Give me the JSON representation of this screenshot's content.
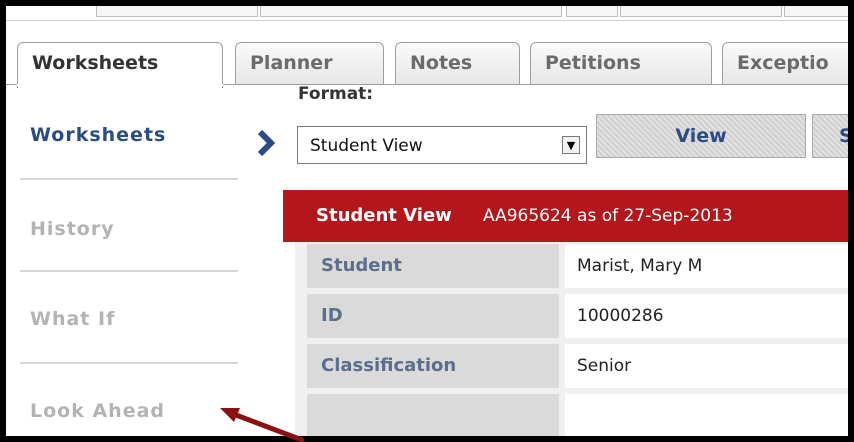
{
  "tabs": [
    {
      "label": "Worksheets"
    },
    {
      "label": "Planner"
    },
    {
      "label": "Notes"
    },
    {
      "label": "Petitions"
    },
    {
      "label": "Exceptio"
    }
  ],
  "nav": {
    "items": [
      {
        "label": "Worksheets"
      },
      {
        "label": "History"
      },
      {
        "label": "What If"
      },
      {
        "label": "Look Ahead"
      }
    ]
  },
  "format": {
    "label": "Format:",
    "selected": "Student View"
  },
  "buttons": {
    "view": "View",
    "second": "S"
  },
  "header": {
    "title": "Student View",
    "subtitle": "AA965624 as of 27-Sep-2013"
  },
  "info": [
    {
      "label": "Student",
      "value": "Marist, Mary M"
    },
    {
      "label": "ID",
      "value": "10000286"
    },
    {
      "label": "Classification",
      "value": "Senior"
    }
  ],
  "colors": {
    "accent_red": "#b3171c",
    "nav_active": "#2a4c84"
  },
  "icons": [
    "chevron-right-icon",
    "dropdown-arrow-icon",
    "red-pointer-arrow-icon"
  ]
}
